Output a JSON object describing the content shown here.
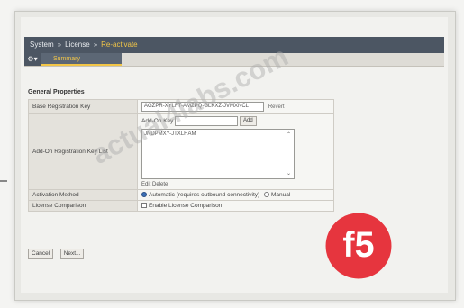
{
  "breadcrumb": {
    "system": "System",
    "license": "License",
    "reactivate": "Re-activate",
    "separator": "»",
    "active_color": "#f2c648"
  },
  "tabs": {
    "gear_icon": "gear-icon",
    "summary": "Summary"
  },
  "section": {
    "title": "General Properties"
  },
  "fields": {
    "base_key_label": "Base Registration Key",
    "base_key_value": "AGZPR-XYLFT-AMZPQ-GLKXZ-JVMXNCL",
    "base_key_trailing": "Revert",
    "addon_label": "Add-On Registration Key List",
    "addon_key_label": "Add-On Key",
    "addon_add_button": "Add",
    "addon_list_items": [
      "JNDPMXY-JTXLHAM"
    ],
    "addon_edit": "Edit",
    "addon_delete": "Delete",
    "activation_label": "Activation Method",
    "activation_auto": "Automatic (requires outbound connectivity)",
    "activation_manual": "Manual",
    "license_comparison_label": "License Comparison",
    "license_comparison_option": "Enable License Comparison"
  },
  "actions": {
    "cancel": "Cancel",
    "next": "Next..."
  },
  "overlay": {
    "watermark": "actual4labs.com",
    "logo_text": "f5",
    "logo_color": "#e4202a"
  }
}
